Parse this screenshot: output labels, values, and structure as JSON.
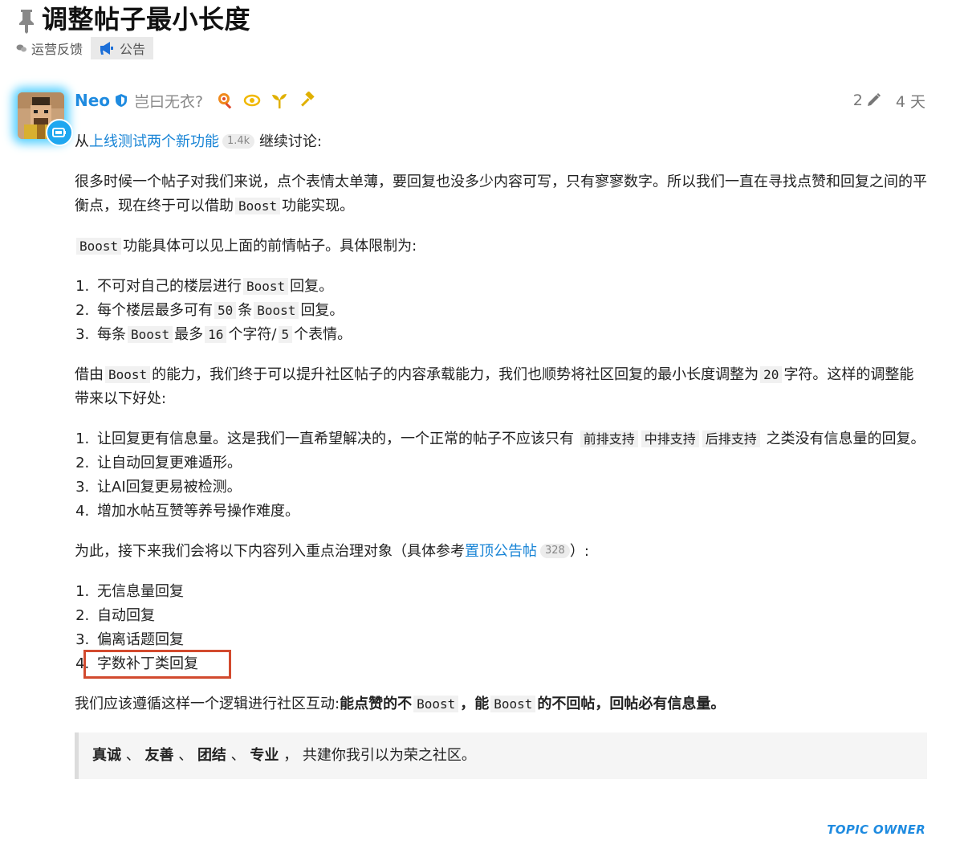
{
  "topic": {
    "title": "调整帖子最小长度",
    "category": "运营反馈",
    "tag": "公告"
  },
  "post": {
    "username": "Neo",
    "user_title": "岂曰无衣?",
    "edit_count": "2",
    "age": "4 天",
    "topic_owner_label": "TOPIC OWNER",
    "colors": {
      "accent": "#1f8be0",
      "highlight_box": "#d24a2e"
    }
  },
  "body": {
    "intro": {
      "prefix": "从",
      "link": "上线测试两个新功能",
      "badge": "1.4k",
      "suffix": "继续讨论:"
    },
    "para1": {
      "text_a": "很多时候一个帖子对我们来说，点个表情太单薄，要回复也没多少内容可写，只有寥寥数字。所以我们一直在寻找点赞和回复之间的平衡点，现在终于可以借助",
      "code": "Boost",
      "text_b": "功能实现。"
    },
    "para2": {
      "code": "Boost",
      "text": "功能具体可以见上面的前情帖子。具体限制为:"
    },
    "limits": [
      {
        "a": "不可对自己的楼层进行",
        "code": "Boost",
        "b": "回复。"
      },
      {
        "a": "每个楼层最多可有",
        "code1": "50",
        "b": "条",
        "code2": "Boost",
        "c": "回复。"
      },
      {
        "a": "每条",
        "code1": "Boost",
        "b": "最多",
        "code2": "16",
        "c": "个字符/",
        "code3": "5",
        "d": "个表情。"
      }
    ],
    "para3": {
      "a": "借由",
      "code1": "Boost",
      "b": "的能力，我们终于可以提升社区帖子的内容承载能力，我们也顺势将社区回复的最小长度调整为",
      "code2": "20",
      "c": "字符。这样的调整能带来以下好处:"
    },
    "benefits": {
      "item1": {
        "a": "让回复更有信息量。这是我们一直希望解决的，一个正常的帖子不应该只有",
        "code1": "前排支持",
        "code2": "中排支持",
        "code3": "后排支持",
        "b": "之类没有信息量的回复。"
      },
      "item2": "让自动回复更难遁形。",
      "item3": "让AI回复更易被检测。",
      "item4": "增加水帖互赞等养号操作难度。"
    },
    "para4": {
      "a": "为此，接下来我们会将以下内容列入重点治理对象（具体参考",
      "link": "置顶公告帖",
      "badge": "328",
      "b": "）:"
    },
    "targets": [
      "无信息量回复",
      "自动回复",
      "偏离话题回复",
      "字数补丁类回复"
    ],
    "para5": {
      "a": "我们应该遵循这样一个逻辑进行社区互动:",
      "bold1": "能点赞的不",
      "code1": "Boost",
      "bold2": "，能",
      "code2": "Boost",
      "bold3": "的不回帖，回帖必有信息量。"
    },
    "quote": {
      "w1": "真诚",
      "sep1": "、",
      "w2": "友善",
      "sep2": "、",
      "w3": "团结",
      "sep3": "、",
      "w4": "专业",
      "comma": "，",
      "tail": "共建你我引以为荣之社区。"
    }
  }
}
